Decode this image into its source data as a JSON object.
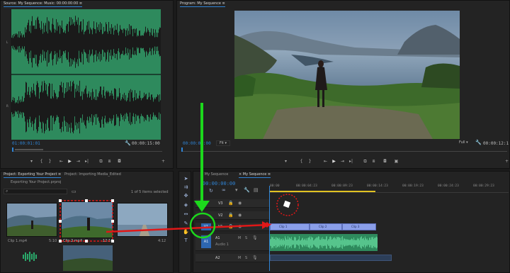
{
  "source_panel": {
    "tab": "Source: My Sequence: Music: 00:00:00:00",
    "timecode_in": "01:00:01:01",
    "timecode_out": "00:00:15:00"
  },
  "program_panel": {
    "tab": "Program: My Sequence",
    "timecode_in": "00:00:00:00",
    "fit": "Fit",
    "quality": "Full",
    "timecode_out": "00:00:12:1"
  },
  "project_panel": {
    "tabs": [
      "Project: Exporting Your Project",
      "Project: Importing Media_Edited"
    ],
    "project_file": "Exporting Your Project.prproj",
    "selection_info": "1 of 5 items selected",
    "clips": [
      {
        "name": "Clip 1.mp4",
        "duration": "5:10"
      },
      {
        "name": "Clip 2.mp4",
        "duration": "12:14"
      },
      {
        "name": "",
        "duration": "4:12"
      }
    ]
  },
  "timeline": {
    "tabs": [
      "My Sequence",
      "My Sequence"
    ],
    "timecode": "00:00:00:00",
    "ruler": [
      "00:00",
      "00:00:04:23",
      "00:00:09:23",
      "00:00:14:23",
      "00:00:19:23",
      "00:00:24:23",
      "00:00:29:23"
    ],
    "tracks": {
      "v3": "V3",
      "v2": "V2",
      "v1": "V1",
      "a1": "A1",
      "a2": "A2",
      "patch_v1": "V1",
      "patch_a1": "A1",
      "audio_name": "Audio 1"
    },
    "clips": [
      "Clip 1",
      "Clip 2",
      "Clip 3"
    ]
  },
  "colors": {
    "accent": "#2f83d4",
    "waveform": "#2aa86a",
    "annotation_arrow_green": "#1cd81c",
    "annotation_arrow_red": "#e01818",
    "selection_dash": "#e01818"
  },
  "icons": [
    "play-icon",
    "step-back-icon",
    "step-forward-icon",
    "mark-in-icon",
    "mark-out-icon",
    "camera-icon",
    "wrench-icon",
    "plus-icon",
    "search-icon",
    "folder-icon",
    "refresh-icon",
    "select-tool-icon",
    "razor-tool-icon",
    "pen-tool-icon",
    "hand-tool-icon",
    "text-tool-icon",
    "lock-icon",
    "eye-icon",
    "mic-icon"
  ]
}
